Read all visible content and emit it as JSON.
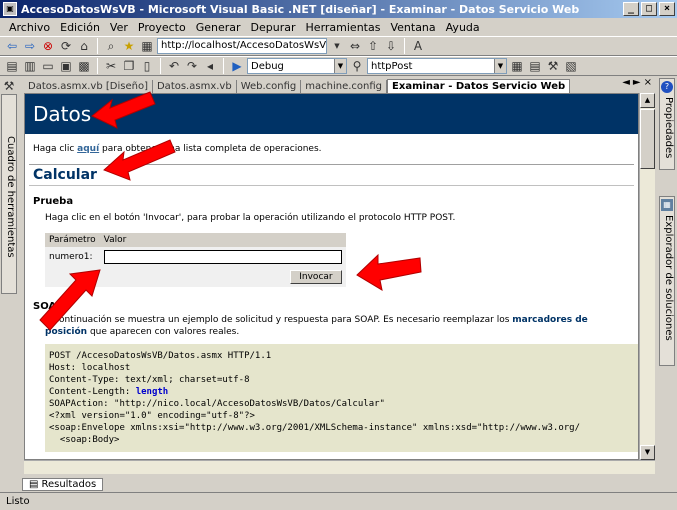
{
  "window": {
    "title": "AccesoDatosWsVB - Microsoft Visual Basic .NET [diseñar] - Examinar - Datos Servicio Web",
    "minimize": "_",
    "maximize": "□",
    "close": "×"
  },
  "menu": [
    "Archivo",
    "Edición",
    "Ver",
    "Proyecto",
    "Generar",
    "Depurar",
    "Herramientas",
    "Ventana",
    "Ayuda"
  ],
  "toolbar": {
    "url": "http://localhost/AccesoDatosWsVB/Datos.a",
    "config": "Debug",
    "method": "httpPost"
  },
  "left_dock": {
    "label": "Cuadro de herramientas"
  },
  "right_dock": {
    "properties": "Propiedades",
    "solution": "Explorador de soluciones",
    "help_icon": "?"
  },
  "doc_tabs": [
    "Datos.asmx.vb [Diseño]",
    "Datos.asmx.vb",
    "Web.config",
    "machine.config",
    "Examinar - Datos Servicio Web"
  ],
  "tab_controls": {
    "left": "◄",
    "right": "►",
    "close": "×"
  },
  "page": {
    "header": "Datos",
    "intro_before": "Haga clic ",
    "intro_link": "aquí",
    "intro_after": " para obtener una lista completa de operaciones.",
    "operation": "Calcular",
    "test_title": "Prueba",
    "test_desc": "Haga clic en el botón 'Invocar', para probar la operación utilizando el protocolo HTTP POST.",
    "param_header": "Parámetro",
    "value_header": "Valor",
    "param_name": "numero1:",
    "invoke_label": "Invocar",
    "soap_title": "SOAP",
    "soap_desc_before": "A continuación se muestra un ejemplo de solicitud y respuesta para SOAP. Es necesario reemplazar los ",
    "soap_desc_bold": "marcadores de posición",
    "soap_desc_after": " que aparecen con valores reales.",
    "code_lines": [
      "POST /AccesoDatosWsVB/Datos.asmx HTTP/1.1",
      "Host: localhost",
      "Content-Type: text/xml; charset=utf-8",
      "Content-Length: ",
      "SOAPAction: \"http://nico.local/AccesoDatosWsVB/Datos/Calcular\"",
      "",
      "<?xml version=\"1.0\" encoding=\"utf-8\"?>",
      "<soap:Envelope xmlns:xsi=\"http://www.w3.org/2001/XMLSchema-instance\" xmlns:xsd=\"http://www.w3.org/",
      "  <soap:Body>"
    ],
    "code_placeholder": "length"
  },
  "bottom_tab": "Resultados",
  "status": "Listo",
  "colors": {
    "header_band": "#003366",
    "arrow": "#ff0000",
    "code_bg": "#e5e5cc"
  }
}
